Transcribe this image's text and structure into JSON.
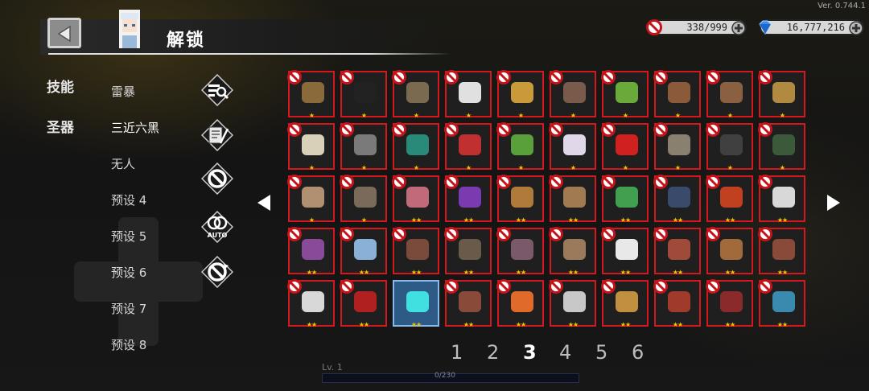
{
  "version": "Ver. 0.744.1",
  "header": {
    "title": "解锁"
  },
  "resources": [
    {
      "name": "forbidden-token",
      "value": "338/999"
    },
    {
      "name": "gems",
      "value": "16,777,216"
    }
  ],
  "categories": [
    {
      "label": "技能"
    },
    {
      "label": "圣器"
    }
  ],
  "presets": [
    "雷暴",
    "三近六黑",
    "无人",
    "预设 4",
    "预设 5",
    "预设 6",
    "预设 7",
    "预设 8"
  ],
  "side_icons": [
    "filter-search-icon",
    "scroll-quill-icon",
    "ban-icon",
    "auto-ban-icon",
    "ban-cycle-icon"
  ],
  "side_icon_labels": {
    "auto": "AUTO"
  },
  "grid": {
    "rows": 5,
    "cols": 10,
    "selected_index": 42,
    "stars": [
      "★",
      "★",
      "★",
      "★",
      "★",
      "★",
      "★",
      "★",
      "★",
      "★",
      "★",
      "★",
      "★",
      "★",
      "★",
      "★",
      "★",
      "★",
      "★",
      "★",
      "★",
      "★",
      "★★",
      "★★",
      "★★",
      "★★",
      "★★",
      "★★",
      "★★",
      "★★",
      "★★",
      "★★",
      "★★",
      "★★",
      "★★",
      "★★",
      "★★",
      "★★",
      "★★",
      "★★",
      "★★",
      "★★",
      "★★",
      "★★",
      "★★",
      "★★",
      "★★",
      "★★",
      "★★",
      "★★"
    ],
    "item_colors": [
      "#8a6a3a",
      "#222222",
      "#7a6a50",
      "#e0e0e0",
      "#c99a3a",
      "#7a5a4a",
      "#6aaa3a",
      "#8a5a3a",
      "#8a6040",
      "#b08a40",
      "#d8d0b8",
      "#7a7a7a",
      "#2a8a7a",
      "#c03030",
      "#5aa03a",
      "#e0d8e8",
      "#d02020",
      "#8a8070",
      "#404040",
      "#3a5a3a",
      "#b09070",
      "#7a6a5a",
      "#c06a7a",
      "#7a3ab0",
      "#b07a3a",
      "#a07a50",
      "#40a050",
      "#3a4a6a",
      "#c04020",
      "#d8d8d8",
      "#8a4a9a",
      "#8ab0d8",
      "#7a4a3a",
      "#6a5a4a",
      "#7a5a6a",
      "#9a7a5a",
      "#e8e8e8",
      "#a04a3a",
      "#a06a3a",
      "#8a4a3a",
      "#d8d8d8",
      "#b02020",
      "#40e0e0",
      "#8a4a3a",
      "#e06a2a",
      "#c8c8c8",
      "#c09040",
      "#a03a2a",
      "#8a2a2a",
      "#3a8ab0"
    ]
  },
  "pagination": {
    "pages": [
      "1",
      "2",
      "3",
      "4",
      "5",
      "6"
    ],
    "current": "3"
  },
  "footer": {
    "level": "Lv. 1",
    "xp": "0/230"
  },
  "colors": {
    "slot_border": "#d3181f",
    "selected_border": "#8ab8e8",
    "star": "#f5c300"
  }
}
